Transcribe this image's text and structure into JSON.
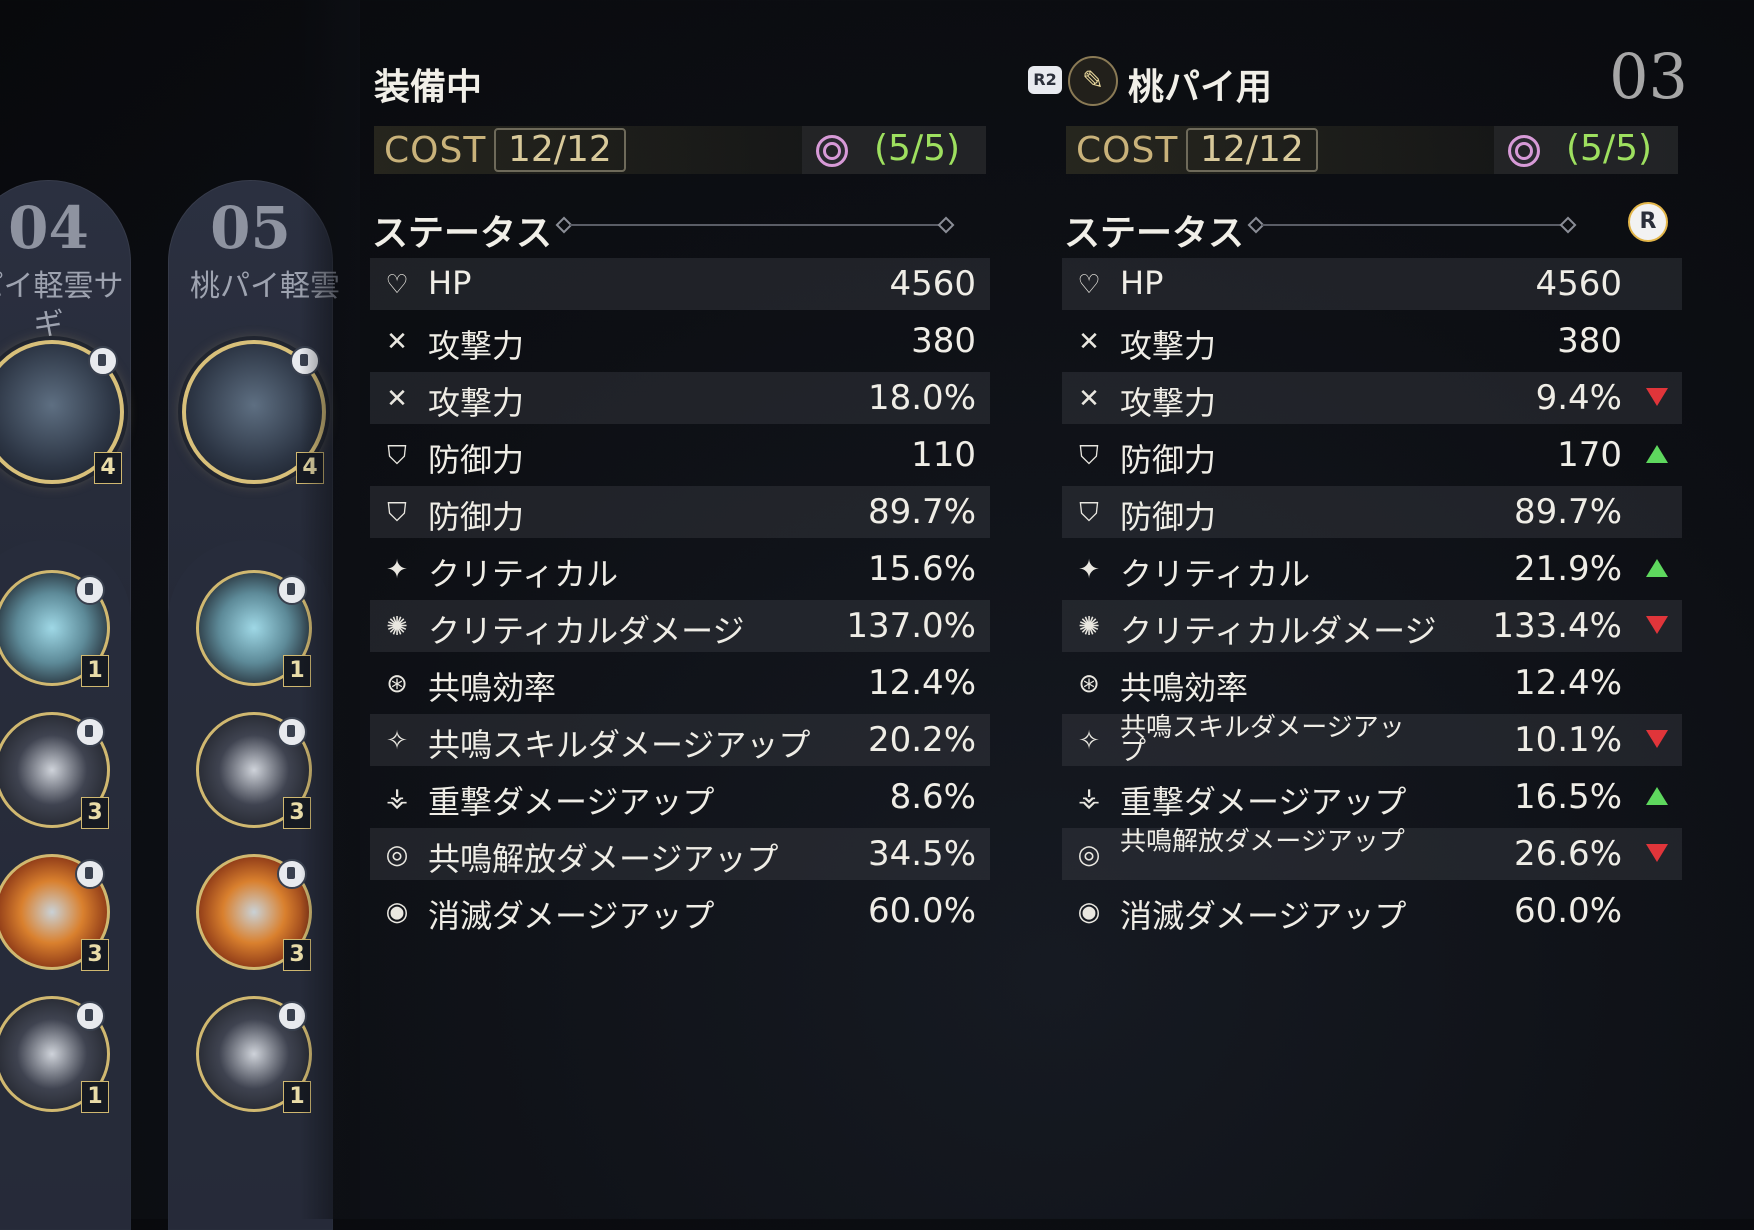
{
  "presets": [
    {
      "number": "04",
      "name": "パイ軽雲サ\nギ",
      "big_level": "4",
      "small_levels": [
        "1",
        "3",
        "3",
        "1"
      ]
    },
    {
      "number": "05",
      "name": "桃パイ軽雲",
      "big_level": "4",
      "small_levels": [
        "1",
        "3",
        "3",
        "1"
      ]
    }
  ],
  "equipped": {
    "title": "装備中",
    "cost_label": "COST",
    "cost_value": "12/12",
    "sonata_value": "(5/5)",
    "status_title": "ステータス",
    "stats": [
      {
        "icon": "hp-icon",
        "label": "HP",
        "value": "4560"
      },
      {
        "icon": "attack-icon",
        "label": "攻撃力",
        "value": "380"
      },
      {
        "icon": "attack-icon",
        "label": "攻撃力",
        "value": "18.0%"
      },
      {
        "icon": "defense-icon",
        "label": "防御力",
        "value": "110"
      },
      {
        "icon": "defense-icon",
        "label": "防御力",
        "value": "89.7%"
      },
      {
        "icon": "crit-icon",
        "label": "クリティカル",
        "value": "15.6%"
      },
      {
        "icon": "crit-dmg-icon",
        "label": "クリティカルダメージ",
        "value": "137.0%"
      },
      {
        "icon": "energy-regen-icon",
        "label": "共鳴効率",
        "value": "12.4%"
      },
      {
        "icon": "skill-dmg-icon",
        "label": "共鳴スキルダメージアップ",
        "value": "20.2%"
      },
      {
        "icon": "heavy-attack-icon",
        "label": "重撃ダメージアップ",
        "value": "8.6%"
      },
      {
        "icon": "liberation-icon",
        "label": "共鳴解放ダメージアップ",
        "value": "34.5%"
      },
      {
        "icon": "havoc-icon",
        "label": "消滅ダメージアップ",
        "value": "60.0%"
      }
    ]
  },
  "compare": {
    "title": "桃パイ用",
    "r2_label": "R2",
    "preset_id": "03",
    "cost_label": "COST",
    "cost_value": "12/12",
    "sonata_value": "(5/5)",
    "status_title": "ステータス",
    "r_button": "R",
    "stats": [
      {
        "icon": "hp-icon",
        "label": "HP",
        "value": "4560",
        "trend": ""
      },
      {
        "icon": "attack-icon",
        "label": "攻撃力",
        "value": "380",
        "trend": ""
      },
      {
        "icon": "attack-icon",
        "label": "攻撃力",
        "value": "9.4%",
        "trend": "down"
      },
      {
        "icon": "defense-icon",
        "label": "防御力",
        "value": "170",
        "trend": "up"
      },
      {
        "icon": "defense-icon",
        "label": "防御力",
        "value": "89.7%",
        "trend": ""
      },
      {
        "icon": "crit-icon",
        "label": "クリティカル",
        "value": "21.9%",
        "trend": "up"
      },
      {
        "icon": "crit-dmg-icon",
        "label": "クリティカルダメージ",
        "value": "133.4%",
        "trend": "down"
      },
      {
        "icon": "energy-regen-icon",
        "label": "共鳴効率",
        "value": "12.4%",
        "trend": ""
      },
      {
        "icon": "skill-dmg-icon",
        "label": "共鳴スキルダメージアップ",
        "value": "10.1%",
        "trend": "down"
      },
      {
        "icon": "heavy-attack-icon",
        "label": "重撃ダメージアップ",
        "value": "16.5%",
        "trend": "up"
      },
      {
        "icon": "liberation-icon",
        "label": "共鳴解放ダメージアップ",
        "value": "26.6%",
        "trend": "down"
      },
      {
        "icon": "havoc-icon",
        "label": "消滅ダメージアップ",
        "value": "60.0%",
        "trend": ""
      }
    ]
  },
  "colors": {
    "up": "#5ed85e",
    "down": "#e0353a",
    "sonata": "#9ee05f",
    "cost": "#c9b27a"
  }
}
